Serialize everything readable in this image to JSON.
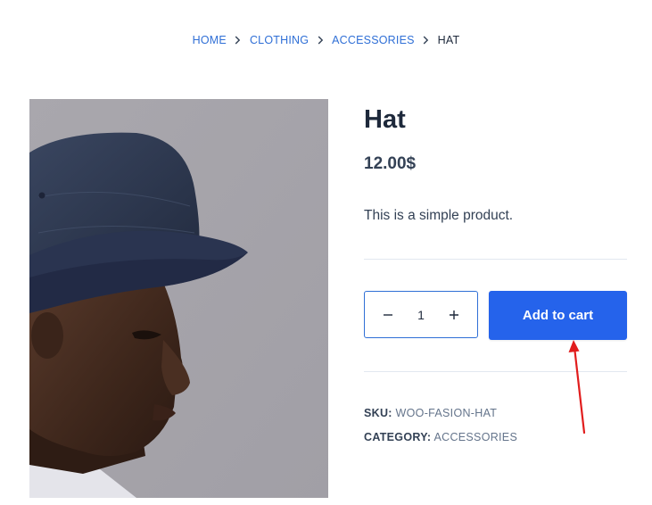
{
  "breadcrumb": {
    "items": [
      "HOME",
      "CLOTHING",
      "ACCESSORIES"
    ],
    "current": "HAT"
  },
  "product": {
    "title": "Hat",
    "price": "12.00$",
    "description": "This is a simple product.",
    "image_alt": "Person wearing a navy bucket hat"
  },
  "cart": {
    "quantity": "1",
    "add_to_cart_label": "Add to cart"
  },
  "meta": {
    "sku_label": "SKU:",
    "sku_value": "WOO-FASION-HAT",
    "category_label": "CATEGORY:",
    "category_value": "ACCESSORIES"
  },
  "colors": {
    "accent": "#2563eb",
    "link": "#2f6fd6",
    "annotation": "#e11d1d"
  }
}
